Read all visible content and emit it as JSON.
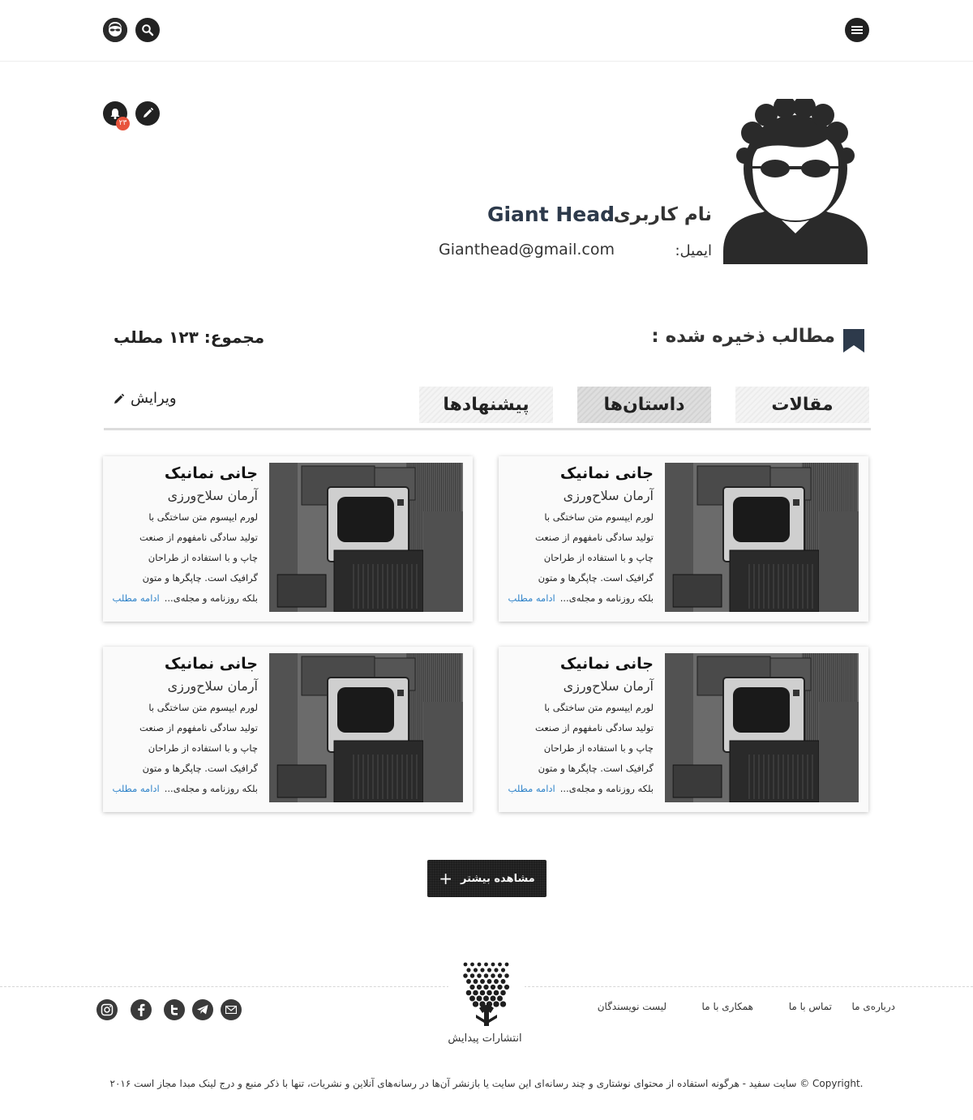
{
  "header": {
    "menu_icon": "hamburger-menu-icon",
    "search_icon": "search-icon",
    "user_icon": "user-avatar-icon"
  },
  "profile": {
    "username_label": "نام کاربری:",
    "username": "Giant Head",
    "email_label": "ایمیل:",
    "email": "Gianthead@gmail.com",
    "notification_count": "۲۳"
  },
  "saved": {
    "title": "مطالب ذخیره شده :",
    "total": "مجموع: ۱۲۳ مطلب"
  },
  "tabs": [
    {
      "label": "مقالات",
      "active": false
    },
    {
      "label": "داستان‌ها",
      "active": true
    },
    {
      "label": "پیشنهادها",
      "active": false
    }
  ],
  "edit_label": "ویرایش",
  "cards": [
    {
      "title": "جانی نمانیک",
      "author": "آرمان سلاح‌ورزی",
      "lines": [
        "لورم ایپسوم متن ساختگی با",
        "تولید سادگی نامفهوم از صنعت",
        "چاپ و با استفاده از طراحان",
        "گرافیک است. چاپگرها و متون",
        "بلکه روزنامه و مجله‌ی..."
      ],
      "more": "ادامه مطلب"
    },
    {
      "title": "جانی نمانیک",
      "author": "آرمان سلاح‌ورزی",
      "lines": [
        "لورم ایپسوم متن ساختگی با",
        "تولید سادگی نامفهوم از صنعت",
        "چاپ و با استفاده از طراحان",
        "گرافیک است. چاپگرها و متون",
        "بلکه روزنامه و مجله‌ی..."
      ],
      "more": "ادامه مطلب"
    },
    {
      "title": "جانی نمانیک",
      "author": "آرمان سلاح‌ورزی",
      "lines": [
        "لورم ایپسوم متن ساختگی با",
        "تولید سادگی نامفهوم از صنعت",
        "چاپ و با استفاده از طراحان",
        "گرافیک است. چاپگرها و متون",
        "بلکه روزنامه و مجله‌ی..."
      ],
      "more": "ادامه مطلب"
    },
    {
      "title": "جانی نمانیک",
      "author": "آرمان سلاح‌ورزی",
      "lines": [
        "لورم ایپسوم متن ساختگی با",
        "تولید سادگی نامفهوم از صنعت",
        "چاپ و با استفاده از طراحان",
        "گرافیک است. چاپگرها و متون",
        "بلکه روزنامه و مجله‌ی..."
      ],
      "more": "ادامه مطلب"
    }
  ],
  "load_more": "مشاهده بیشتر",
  "footer": {
    "links": [
      "درباره‌ی ما",
      "تماس با ما",
      "همکاری با ما",
      "لیست نویسندگان"
    ],
    "logo_caption": "انتشارات پیدایش",
    "social_icons": [
      "email-icon",
      "telegram-icon",
      "twitter-icon",
      "facebook-icon",
      "instagram-icon"
    ],
    "copyright": "سایت سفید - هرگونه استفاده از محتوای نوشتاری و چند رسانه‌ای این سایت یا بازنشر آن‌ها در رسانه‌های آنلاین و نشریات، تنها با ذکر منبع و درج لینک مبدا مجاز است ۲۰۱۶ © Copyright."
  },
  "colors": {
    "dark": "#222222",
    "link": "#2f83c9",
    "badge": "#e8543c",
    "bookmark": "#2d3a4b"
  }
}
